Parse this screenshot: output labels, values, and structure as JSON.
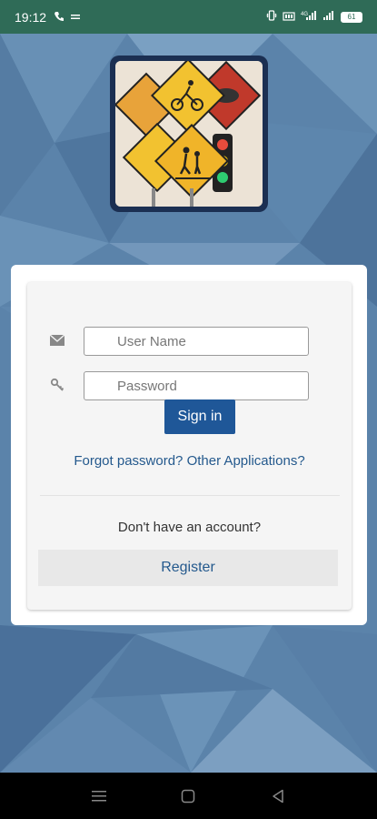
{
  "status_bar": {
    "time": "19:12",
    "battery_level": "61"
  },
  "login": {
    "username_placeholder": "User Name",
    "password_placeholder": "Password",
    "signin_label": "Sign in",
    "forgot_link": "Forgot password?",
    "other_apps_link": "Other Applications?",
    "no_account_text": "Don't have an account?",
    "register_label": "Register"
  },
  "colors": {
    "status_bar": "#2f6b57",
    "primary": "#1f5798",
    "link": "#24598d",
    "background": "#5b83aa"
  },
  "icons": [
    "envelope-icon",
    "key-icon",
    "menu-icon",
    "home-icon",
    "back-icon"
  ]
}
